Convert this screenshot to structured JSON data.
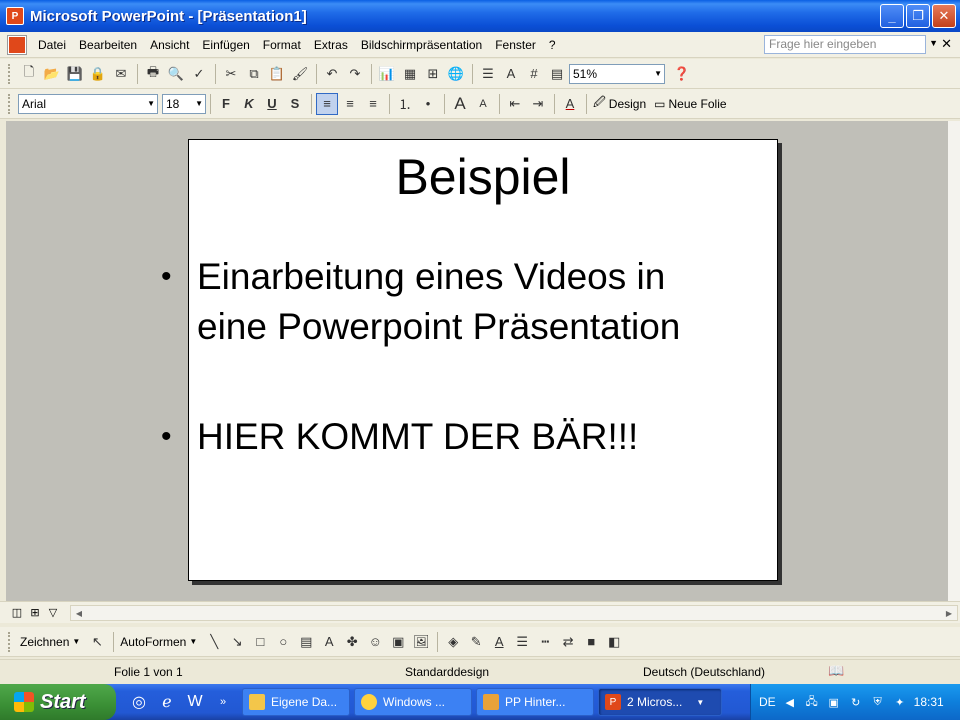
{
  "window": {
    "title": "Microsoft PowerPoint - [Präsentation1]"
  },
  "menu": {
    "items": [
      "Datei",
      "Bearbeiten",
      "Ansicht",
      "Einfügen",
      "Format",
      "Extras",
      "Bildschirmpräsentation",
      "Fenster",
      "?"
    ],
    "help_placeholder": "Frage hier eingeben"
  },
  "standard_toolbar": {
    "zoom": "51%"
  },
  "format_toolbar": {
    "font": "Arial",
    "size": "18",
    "bold_glyph": "F",
    "italic_glyph": "K",
    "underline_glyph": "U",
    "shadow_glyph": "S",
    "design_label": "Design",
    "new_slide_label": "Neue Folie"
  },
  "slide": {
    "title": "Beispiel",
    "bullets": [
      "Einarbeitung eines Videos in eine Powerpoint Präsentation",
      "HIER KOMMT DER BÄR!!!"
    ]
  },
  "drawing_toolbar": {
    "draw_label": "Zeichnen",
    "autoshapes_label": "AutoFormen"
  },
  "statusbar": {
    "slide_info": "Folie 1 von 1",
    "design": "Standarddesign",
    "language": "Deutsch (Deutschland)"
  },
  "taskbar": {
    "start_label": "Start",
    "tasks": [
      "Eigene Da...",
      "Windows ...",
      "PP Hinter...",
      "2 Micros..."
    ],
    "tray_lang": "DE",
    "clock": "18:31"
  }
}
